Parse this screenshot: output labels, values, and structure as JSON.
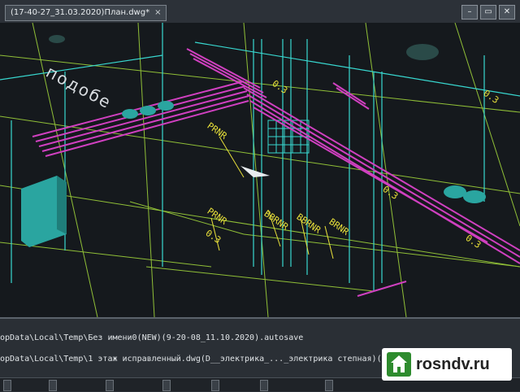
{
  "window": {
    "tab_title": "(17-40-27_31.03.2020)План.dwg*",
    "tab_close": "×",
    "buttons": [
      "–",
      "▭",
      "✕"
    ]
  },
  "drawing": {
    "labels": [
      "PRNR",
      "PRNR",
      "0.3",
      "0.3",
      "BBRNR",
      "BBRNR",
      "BRNR",
      "0.3",
      "0.3",
      "0.3"
    ],
    "room_label": "подобе",
    "colors": {
      "background": "#15191d",
      "magenta": "#d040c0",
      "cyan": "#38d8d0",
      "green": "#9ed23a",
      "teal_block": "#2aa5a0",
      "text_yellow": "#e8e03a"
    }
  },
  "command": {
    "lines": [
      "opData\\Local\\Temp\\Без имени0(NEW)(9-20-08_11.10.2020).autosave",
      "opData\\Local\\Temp\\1 этаж исправленный.dwg(D__электрика_..._электрика степная)(9-20-",
      ""
    ]
  },
  "status": {
    "items": [
      "",
      "",
      "",
      "",
      "",
      "",
      ""
    ]
  },
  "watermark": {
    "icon": "house-icon",
    "text": "rosndv.ru"
  }
}
